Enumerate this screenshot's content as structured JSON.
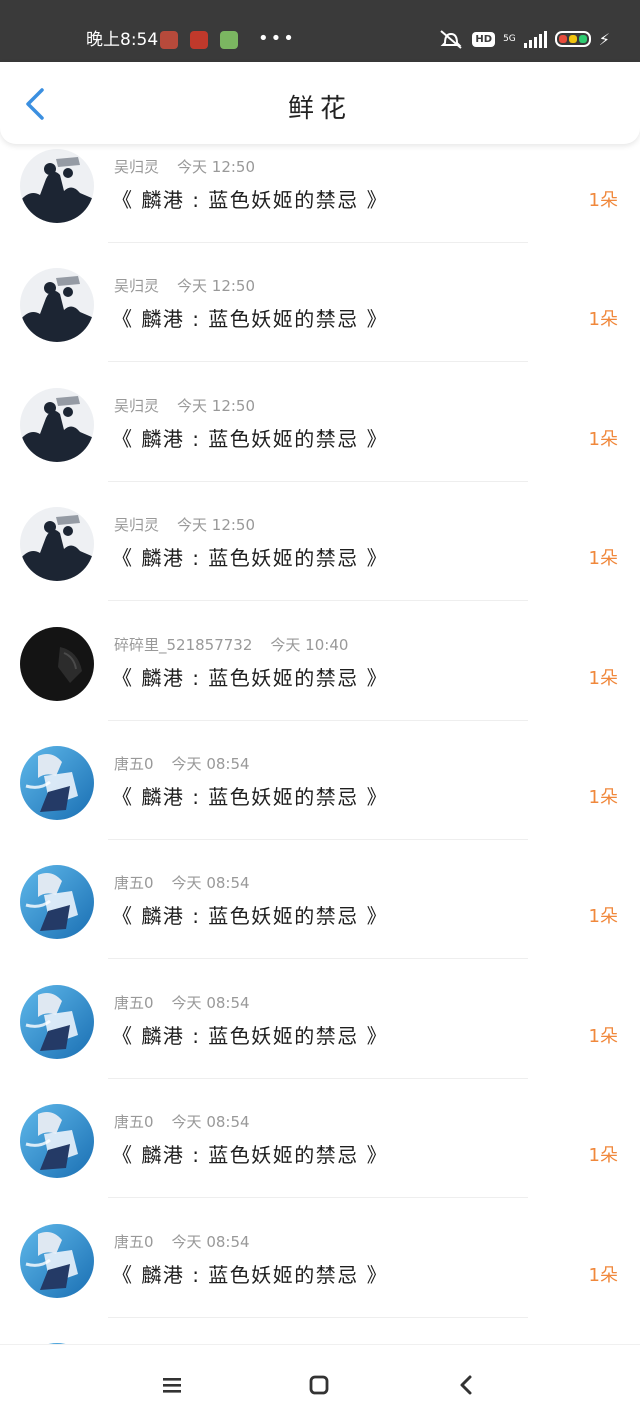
{
  "status_bar": {
    "time": "晚上8:54",
    "more": "•••",
    "network": "5G",
    "hd": "HD",
    "app_icons": [
      "app-icon-1",
      "app-icon-2",
      "app-icon-3"
    ],
    "icons": [
      "mute-icon",
      "hd-icon",
      "signal-icon",
      "battery-icon",
      "charging-icon"
    ]
  },
  "header": {
    "title": "鲜花",
    "back_icon": "back-chevron-icon"
  },
  "colors": {
    "accent": "#3b8fe0",
    "count": "#f0883c",
    "meta": "#999999",
    "status_bg": "#3a3a3a"
  },
  "records": [
    {
      "user": "吴归灵",
      "time": "今天 12:50",
      "book": "《 麟港 : 蓝色妖姬的禁忌 》",
      "count": "1朵",
      "avatar": "dark-figure"
    },
    {
      "user": "吴归灵",
      "time": "今天 12:50",
      "book": "《 麟港 : 蓝色妖姬的禁忌 》",
      "count": "1朵",
      "avatar": "dark-figure"
    },
    {
      "user": "吴归灵",
      "time": "今天 12:50",
      "book": "《 麟港 : 蓝色妖姬的禁忌 》",
      "count": "1朵",
      "avatar": "dark-figure"
    },
    {
      "user": "吴归灵",
      "time": "今天 12:50",
      "book": "《 麟港 : 蓝色妖姬的禁忌 》",
      "count": "1朵",
      "avatar": "dark-figure"
    },
    {
      "user": "碎碎里_521857732",
      "time": "今天 10:40",
      "book": "《 麟港 : 蓝色妖姬的禁忌 》",
      "count": "1朵",
      "avatar": "black"
    },
    {
      "user": "唐五0",
      "time": "今天 08:54",
      "book": "《 麟港 : 蓝色妖姬的禁忌 》",
      "count": "1朵",
      "avatar": "blue-anime"
    },
    {
      "user": "唐五0",
      "time": "今天 08:54",
      "book": "《 麟港 : 蓝色妖姬的禁忌 》",
      "count": "1朵",
      "avatar": "blue-anime"
    },
    {
      "user": "唐五0",
      "time": "今天 08:54",
      "book": "《 麟港 : 蓝色妖姬的禁忌 》",
      "count": "1朵",
      "avatar": "blue-anime"
    },
    {
      "user": "唐五0",
      "time": "今天 08:54",
      "book": "《 麟港 : 蓝色妖姬的禁忌 》",
      "count": "1朵",
      "avatar": "blue-anime"
    },
    {
      "user": "唐五0",
      "time": "今天 08:54",
      "book": "《 麟港 : 蓝色妖姬的禁忌 》",
      "count": "1朵",
      "avatar": "blue-anime"
    },
    {
      "user": "",
      "time": "",
      "book": "",
      "count": "",
      "avatar": "blue-anime"
    }
  ],
  "nav": {
    "icons": [
      "menu-icon",
      "home-icon",
      "back-icon"
    ]
  }
}
